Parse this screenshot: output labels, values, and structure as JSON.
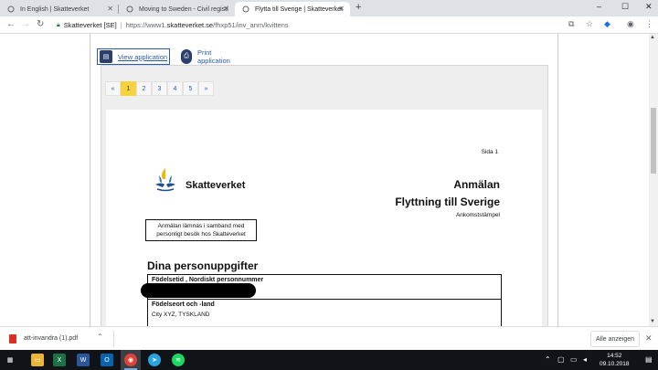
{
  "browser": {
    "tabs": [
      {
        "label": "In English | Skatteverket",
        "active": false
      },
      {
        "label": "Moving to Sweden - Civil registi",
        "active": false
      },
      {
        "label": "Flytta till Sverige | Skatteverket",
        "active": true
      }
    ],
    "new_tab_symbol": "+",
    "window_controls": [
      "–",
      "☐",
      "✕"
    ],
    "omnibox": {
      "site_name": "Skatteverket [SE]",
      "url_prefix": "https://www1.",
      "url_domain": "skatteverket.se",
      "url_path": "/fhxp51/inv_anm/kvittens"
    },
    "toolbar_icons": [
      "translate-icon",
      "star-icon",
      "extension-icon",
      "profile-icon",
      "menu-icon"
    ]
  },
  "page": {
    "view_application": "View application",
    "print_application": "Print application",
    "pager": {
      "first": "«",
      "pages": [
        "1",
        "2",
        "3",
        "4",
        "5"
      ],
      "current": "1",
      "last": "»"
    },
    "document": {
      "page_label": "Sida 1",
      "brand": "Skatteverket",
      "title_line1": "Anmälan",
      "title_line2": "Flyttning till Sverige",
      "stamp_label": "Ankomststämpel",
      "notice": "Anmälan lämnas i samband med personligt besök hos Skatteverket",
      "section_title": "Dina personuppgifter",
      "fields": [
        {
          "label": "Födelsetid , Nordiskt personnummer",
          "value": ""
        },
        {
          "label": "Födelseort och -land",
          "value": "City XYZ, TYSKLAND"
        }
      ]
    }
  },
  "downloads": {
    "file_name": "att-invandra (1).pdf",
    "show_all": "Alle anzeigen"
  },
  "taskbar": {
    "time": "14:52",
    "date": "09.10.2018"
  },
  "colors": {
    "link_blue": "#2a5caa",
    "pager_active": "#f6d23c",
    "navy": "#2a3f6b"
  }
}
